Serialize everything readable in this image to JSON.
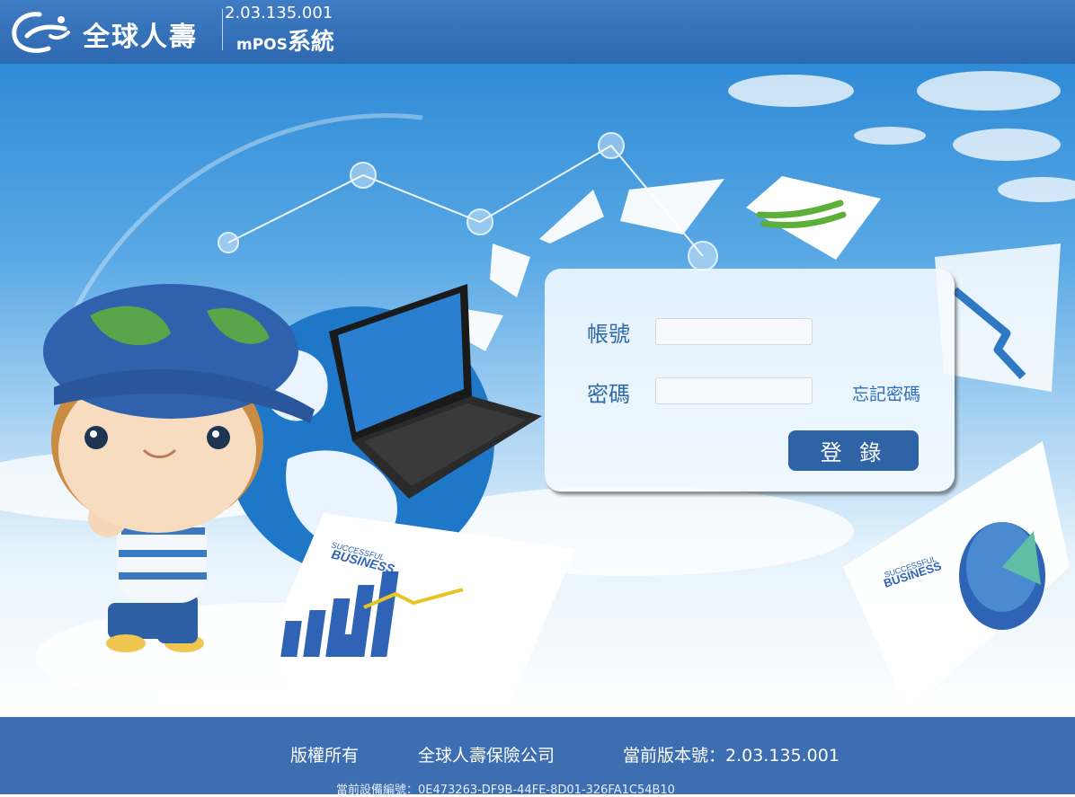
{
  "header": {
    "logo_text": "全球人壽",
    "version": "2.03.135.001",
    "app_name_prefix": "mPOS",
    "app_name_suffix": "系統"
  },
  "login": {
    "account_label": "帳號",
    "password_label": "密碼",
    "account_value": "",
    "password_value": "",
    "forgot_password": "忘記密碼",
    "login_button": "登 錄"
  },
  "art": {
    "brochure_left_small": "SUCCESSFUL",
    "brochure_left_big": "BUSINESS",
    "brochure_right_small": "SUCCESSFUL",
    "brochure_right_big": "BUSINESS"
  },
  "footer": {
    "copyright": "版權所有",
    "company": "全球人壽保險公司",
    "version_label": "當前版本號：2.03.135.001",
    "device_id": "當前設備編號：0E473263-DF9B-44FE-8D01-326FA1C54B10"
  },
  "colors": {
    "header_bg": "#2d68b0",
    "footer_bg": "#3c6eb1",
    "button_bg": "#2e63a5",
    "label_color": "#2f6aa8"
  }
}
